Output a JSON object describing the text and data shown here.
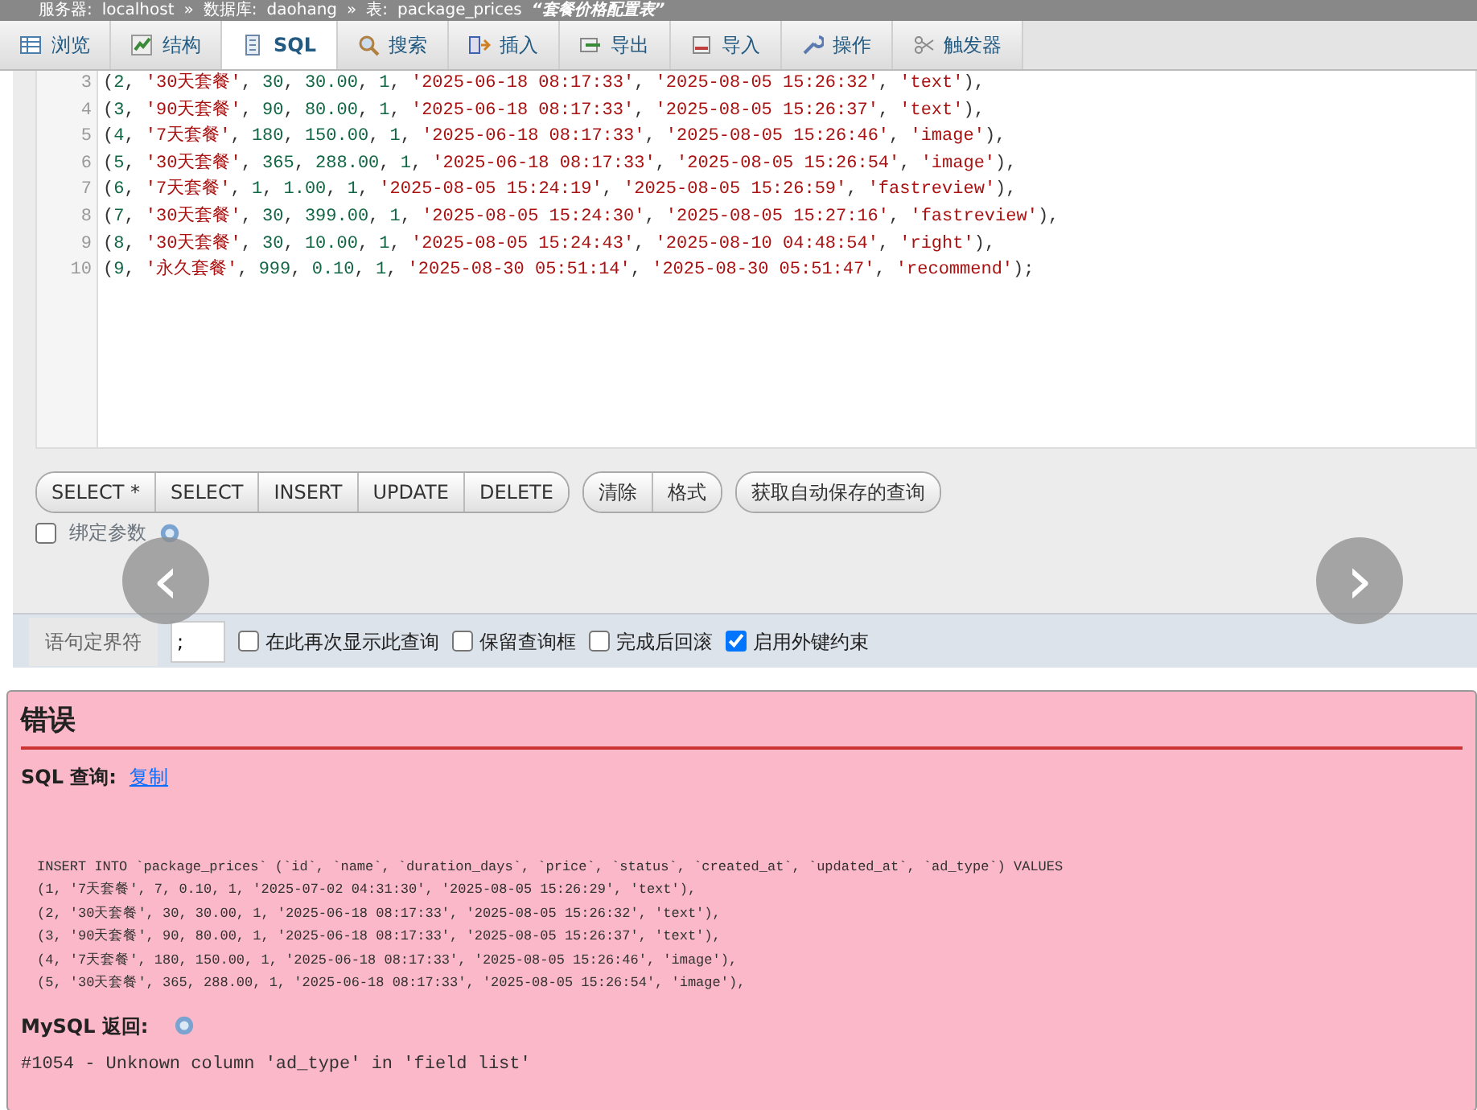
{
  "breadcrumb": [
    {
      "label": "服务器:",
      "value": "localhost"
    },
    {
      "separator": "»",
      "label": "数据库:",
      "value": "daohang"
    },
    {
      "separator": "»",
      "label": "表:",
      "value": "package_prices"
    }
  ],
  "table_comment": "“套餐价格配置表”",
  "tabs": [
    {
      "label": "浏览",
      "selected": false
    },
    {
      "label": "结构",
      "selected": false
    },
    {
      "label": "SQL",
      "selected": true
    },
    {
      "label": "搜索",
      "selected": false
    },
    {
      "label": "插入",
      "selected": false
    },
    {
      "label": "导出",
      "selected": false
    },
    {
      "label": "导入",
      "selected": false
    },
    {
      "label": "操作",
      "selected": false
    },
    {
      "label": "触发器",
      "selected": false
    }
  ],
  "editor": {
    "lines": [
      {
        "number": "3",
        "code": "(2, '30天套餐', 30, 30.00, 1, '2025-06-18 08:17:33', '2025-08-05 15:26:32', 'text'),"
      },
      {
        "number": "4",
        "code": "(3, '90天套餐', 90, 80.00, 1, '2025-06-18 08:17:33', '2025-08-05 15:26:37', 'text'),"
      },
      {
        "number": "5",
        "code": "(4, '7天套餐', 180, 150.00, 1, '2025-06-18 08:17:33', '2025-08-05 15:26:46', 'image'),"
      },
      {
        "number": "6",
        "code": "(5, '30天套餐', 365, 288.00, 1, '2025-06-18 08:17:33', '2025-08-05 15:26:54', 'image'),"
      },
      {
        "number": "7",
        "code": "(6, '7天套餐', 1, 1.00, 1, '2025-08-05 15:24:19', '2025-08-05 15:26:59', 'fastreview'),"
      },
      {
        "number": "8",
        "code": "(7, '30天套餐', 30, 399.00, 1, '2025-08-05 15:24:30', '2025-08-05 15:27:16', 'fastreview'),"
      },
      {
        "number": "9",
        "code": "(8, '30天套餐', 30, 10.00, 1, '2025-08-05 15:24:43', '2025-08-10 04:48:54', 'right'),"
      },
      {
        "number": "10",
        "code": "(9, '永久套餐', 999, 0.10, 1, '2025-08-30 05:51:14', '2025-08-30 05:51:47', 'recommend');"
      }
    ]
  },
  "query_buttons": [
    [
      "SELECT *",
      "SELECT",
      "INSERT",
      "UPDATE",
      "DELETE"
    ],
    [
      "清除",
      "格式"
    ],
    [
      "获取自动保存的查询"
    ]
  ],
  "bind_parameters": {
    "label": "绑定参数",
    "checked": false
  },
  "delimiter": {
    "label": "语句定界符",
    "value": ";"
  },
  "options": [
    {
      "label": "在此再次显示此查询",
      "checked": false
    },
    {
      "label": "保留查询框",
      "checked": false
    },
    {
      "label": "完成后回滚",
      "checked": false
    },
    {
      "label": "启用外键约束",
      "checked": true
    }
  ],
  "error": {
    "title": "错误",
    "sql_label": "SQL 查询:",
    "copy_link": "复制",
    "sql_lines": [
      "INSERT INTO `package_prices` (`id`, `name`, `duration_days`, `price`, `status`, `created_at`, `updated_at`, `ad_type`) VALUES",
      "(1, '7天套餐', 7, 0.10, 1, '2025-07-02 04:31:30', '2025-08-05 15:26:29', 'text'),",
      "(2, '30天套餐', 30, 30.00, 1, '2025-06-18 08:17:33', '2025-08-05 15:26:32', 'text'),",
      "(3, '90天套餐', 90, 80.00, 1, '2025-06-18 08:17:33', '2025-08-05 15:26:37', 'text'),",
      "(4, '7天套餐', 180, 150.00, 1, '2025-06-18 08:17:33', '2025-08-05 15:26:46', 'image'),",
      "(5, '30天套餐', 365, 288.00, 1, '2025-06-18 08:17:33', '2025-08-05 15:26:54', 'image'),"
    ],
    "mysql_label": "MySQL 返回:",
    "message": "#1054 - Unknown column 'ad_type' in 'field list'"
  },
  "carousel": {
    "prev": "‹",
    "next": "›"
  }
}
